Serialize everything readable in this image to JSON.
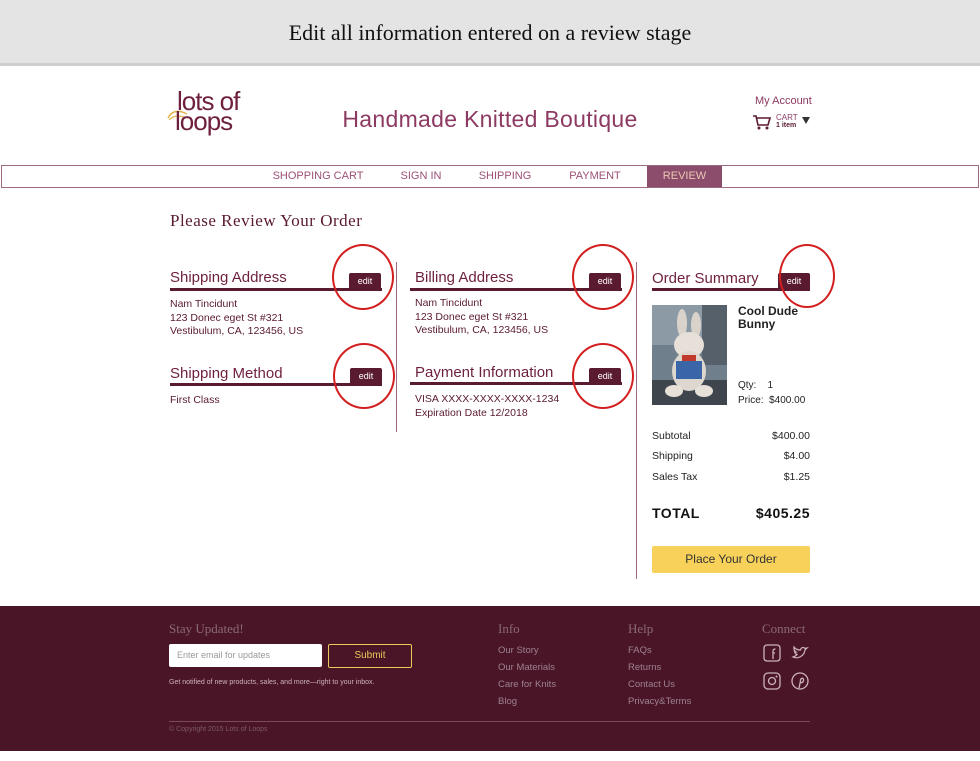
{
  "banner": {
    "caption": "Edit all information entered on a review stage"
  },
  "header": {
    "logo_line1": "lots of",
    "logo_line2": "loops",
    "site_title": "Handmade Knitted Boutique",
    "my_account": "My Account",
    "cart_label": "CART",
    "cart_count": "1 item"
  },
  "nav": {
    "items": [
      "SHOPPING CART",
      "SIGN IN",
      "SHIPPING",
      "PAYMENT",
      "REVIEW"
    ],
    "active": "REVIEW"
  },
  "review": {
    "heading": "Please Review Your Order",
    "edit_label": "edit",
    "shipping_address": {
      "title": "Shipping Address",
      "name": "Nam Tincidunt",
      "street": "123 Donec eget St #321",
      "city": "Vestibulum, CA, 123456, US"
    },
    "billing_address": {
      "title": "Billing Address",
      "name": "Nam Tincidunt",
      "street": "123 Donec eget St #321",
      "city": "Vestibulum, CA, 123456, US"
    },
    "shipping_method": {
      "title": "Shipping Method",
      "value": "First Class"
    },
    "payment_information": {
      "title": "Payment Information",
      "card": "VISA XXXX-XXXX-XXXX-1234",
      "expiration": "Expiration Date 12/2018"
    }
  },
  "order_summary": {
    "title": "Order Summary",
    "product_name": "Cool Dude Bunny",
    "qty_label": "Qty:",
    "qty_value": "1",
    "price_label": "Price:",
    "price_value": "$400.00",
    "subtotal_label": "Subtotal",
    "subtotal_value": "$400.00",
    "shipping_label": "Shipping",
    "shipping_value": "$4.00",
    "tax_label": "Sales Tax",
    "tax_value": "$1.25",
    "total_label": "TOTAL",
    "total_value": "$405.25",
    "place_order": "Place Your Order"
  },
  "footer": {
    "stay_updated": "Stay Updated!",
    "email_placeholder": "Enter email for updates",
    "submit": "Submit",
    "note": "Get notified of new products, sales, and more—right to your inbox.",
    "info_heading": "Info",
    "info_links": [
      "Our Story",
      "Our Materials",
      "Care for Knits",
      "Blog"
    ],
    "help_heading": "Help",
    "help_links": [
      "FAQs",
      "Returns",
      "Contact Us",
      "Privacy&Terms"
    ],
    "connect_heading": "Connect",
    "social_icons": [
      "facebook-icon",
      "twitter-icon",
      "instagram-icon",
      "pinterest-icon"
    ],
    "copyright": "© Copyright 2015 Lots of Loops"
  },
  "colors": {
    "brand": "#5a1a30",
    "accent": "#f7d15a",
    "nav_active": "#8c4c6c",
    "annotation": "#d31f1f"
  }
}
